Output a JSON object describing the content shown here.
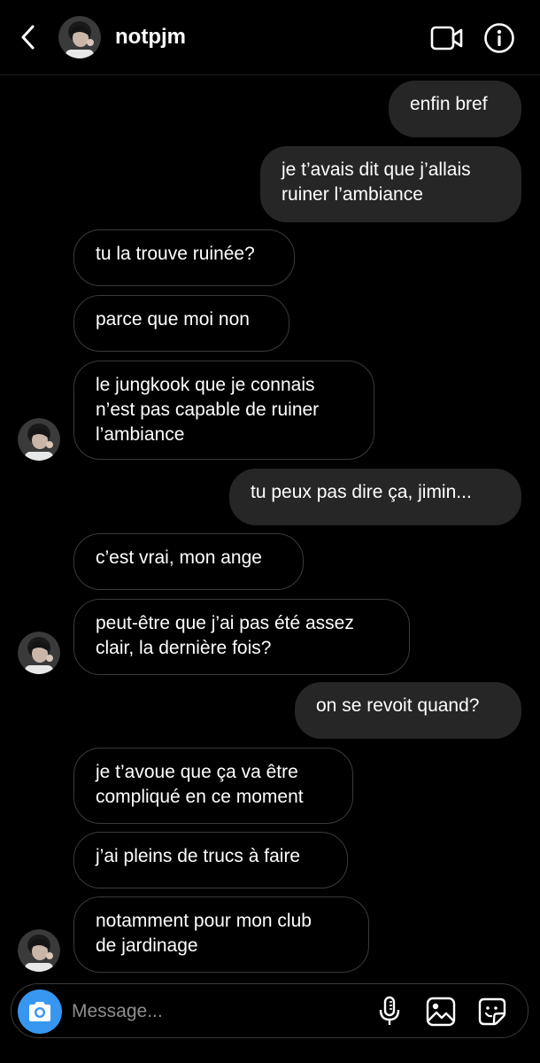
{
  "header": {
    "username": "notpjm"
  },
  "composer": {
    "placeholder": "Message..."
  },
  "messages": [
    {
      "from": "me",
      "text": "enfin bref"
    },
    {
      "from": "me",
      "text": "je t’avais dit que j’allais\nruiner l’ambiance"
    },
    {
      "from": "them",
      "text": "tu la trouve ruinée?"
    },
    {
      "from": "them",
      "text": "parce que moi non"
    },
    {
      "from": "them",
      "text": "le jungkook que je connais\nn’est pas capable de ruiner\nl’ambiance"
    },
    {
      "from": "me",
      "text": "tu peux pas dire ça, jimin..."
    },
    {
      "from": "them",
      "text": "c’est vrai, mon ange"
    },
    {
      "from": "them",
      "text": "peut-être que j’ai pas été assez\nclair, la dernière fois?"
    },
    {
      "from": "me",
      "text": "on se revoit quand?"
    },
    {
      "from": "them",
      "text": "je t’avoue que ça va être\ncompliqué en ce moment"
    },
    {
      "from": "them",
      "text": "j’ai pleins de trucs à faire"
    },
    {
      "from": "them",
      "text": "notamment pour mon club\nde jardinage"
    }
  ],
  "icons": {
    "back": "chevron-left-icon",
    "video": "video-camera-icon",
    "info": "info-icon",
    "camera": "camera-icon",
    "mic": "microphone-icon",
    "gallery": "image-icon",
    "sticker": "sticker-icon"
  },
  "colors": {
    "background": "#000000",
    "sent_bubble": "#262626",
    "received_border": "#3a3a3a",
    "camera_button": "#3797f0",
    "placeholder": "#8e8e8e"
  }
}
